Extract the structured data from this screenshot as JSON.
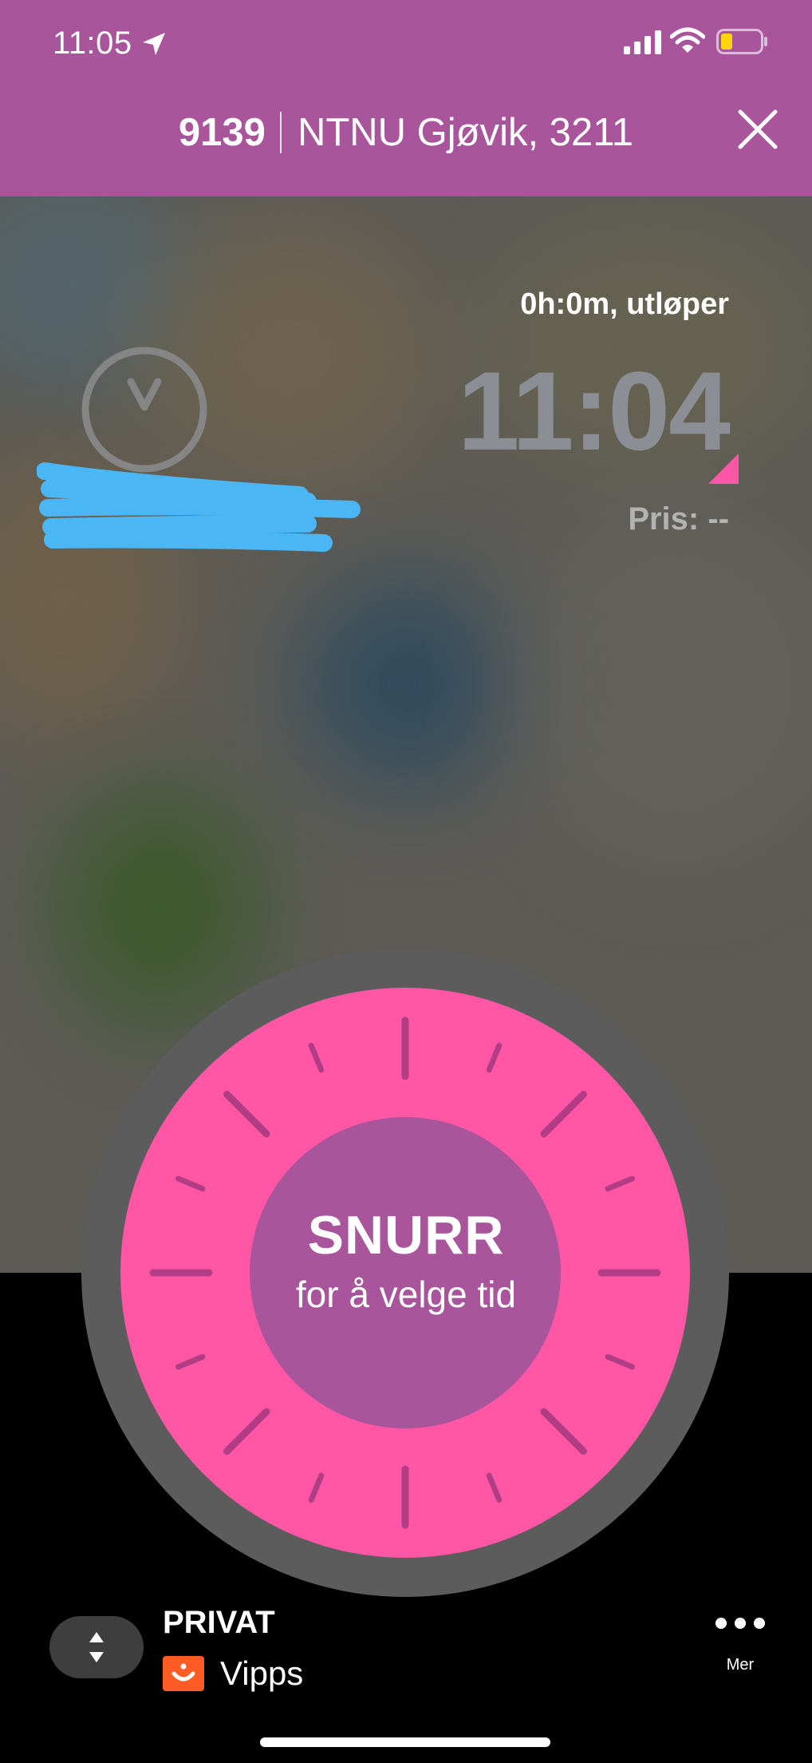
{
  "status_bar": {
    "time": "11:05"
  },
  "header": {
    "zone_number": "9139",
    "zone_name": "NTNU Gjøvik, 3211"
  },
  "session": {
    "duration_text": "0h:0m, utløper",
    "end_time": "11:04",
    "price_text": "Pris: --"
  },
  "dial": {
    "title": "SNURR",
    "subtitle": "for å velge tid"
  },
  "payment": {
    "account_type": "PRIVAT",
    "method": "Vipps",
    "more_label": "Mer"
  },
  "colors": {
    "header_bg": "#a9559c",
    "dial_outer": "#ff56a5",
    "dial_inner": "#a9559c",
    "redaction": "#4ab6f4",
    "vipps": "#ff5b24"
  },
  "icons": [
    "location-arrow-icon",
    "signal-icon",
    "wifi-icon",
    "battery-icon",
    "close-icon",
    "clock-icon",
    "reorder-icon",
    "vipps-logo-icon",
    "more-icon"
  ]
}
